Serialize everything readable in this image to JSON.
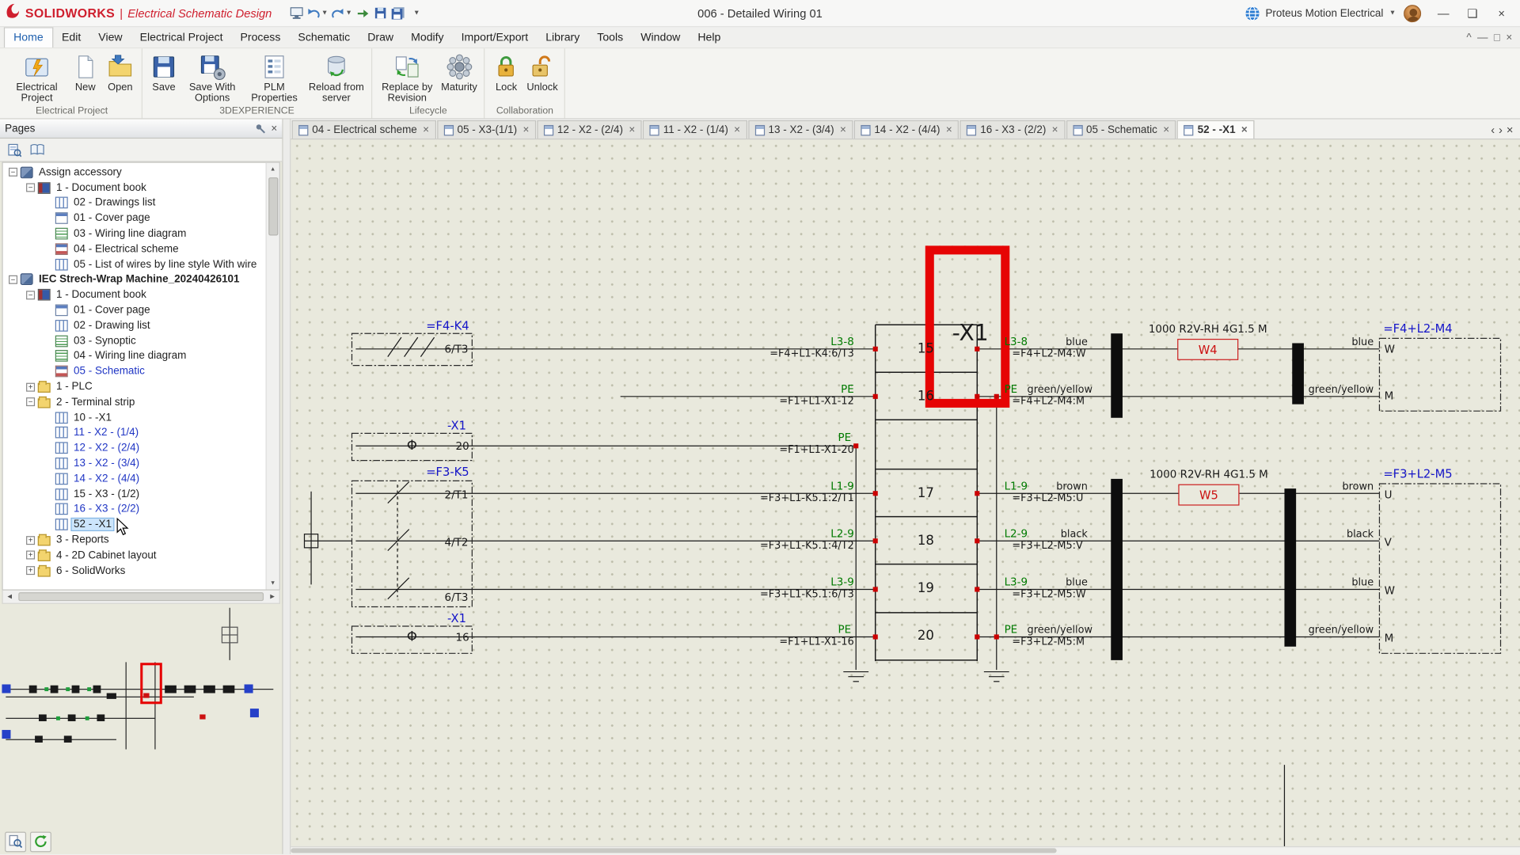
{
  "colors": {
    "brand_red": "#cf1f2e",
    "canvas_beige": "#e9e9dd",
    "wire_label_green": "#007a00",
    "component_tag_blue": "#1414c8",
    "highlight_red": "#e60404",
    "cable_tag_red": "#cc1111",
    "selection_blue": "#cce5fb"
  },
  "title_bar": {
    "brand": "SOLIDWORKS",
    "divider": "|",
    "product": "Electrical Schematic Design",
    "document_title": "006 - Detailed Wiring 01",
    "account_name": "Proteus Motion Electrical",
    "quick_access_icons": [
      "viewer",
      "undo",
      "redo",
      "export",
      "save",
      "save-all",
      "customize"
    ]
  },
  "menu": {
    "active": "Home",
    "items": [
      "Home",
      "Edit",
      "View",
      "Electrical Project",
      "Process",
      "Schematic",
      "Draw",
      "Modify",
      "Import/Export",
      "Library",
      "Tools",
      "Window",
      "Help"
    ]
  },
  "ribbon": {
    "groups": [
      {
        "label": "Electrical Project",
        "buttons": [
          {
            "label": "Electrical Project",
            "icon": "electrical-project"
          },
          {
            "label": "New",
            "icon": "new-document"
          },
          {
            "label": "Open",
            "icon": "open"
          }
        ]
      },
      {
        "label": "3DEXPERIENCE",
        "buttons": [
          {
            "label": "Save",
            "icon": "save"
          },
          {
            "label": "Save With Options",
            "icon": "save-options"
          },
          {
            "label": "PLM Properties",
            "icon": "plm-properties"
          },
          {
            "label": "Reload from server",
            "icon": "reload-server"
          }
        ]
      },
      {
        "label": "Lifecycle",
        "buttons": [
          {
            "label": "Replace by Revision",
            "icon": "replace-revision"
          },
          {
            "label": "Maturity",
            "icon": "maturity"
          }
        ]
      },
      {
        "label": "Collaboration",
        "buttons": [
          {
            "label": "Lock",
            "icon": "lock"
          },
          {
            "label": "Unlock",
            "icon": "unlock"
          }
        ]
      }
    ]
  },
  "pages_panel": {
    "title": "Pages",
    "tree": [
      {
        "label": "Assign accessory",
        "level": 0,
        "icon": "project",
        "twisty": "minus"
      },
      {
        "label": "1 - Document book",
        "level": 1,
        "icon": "book",
        "twisty": "minus"
      },
      {
        "label": "02 - Drawings list",
        "level": 2,
        "icon": "table",
        "twisty": "none"
      },
      {
        "label": "01 - Cover page",
        "level": 2,
        "icon": "page",
        "twisty": "none"
      },
      {
        "label": "03 - Wiring line diagram",
        "level": 2,
        "icon": "page-green",
        "twisty": "none"
      },
      {
        "label": "04 - Electrical scheme",
        "level": 2,
        "icon": "scheme",
        "twisty": "none"
      },
      {
        "label": "05 - List of wires by line style With wire",
        "level": 2,
        "icon": "table",
        "twisty": "none"
      },
      {
        "label": "IEC Strech-Wrap Machine_20240426101",
        "level": 0,
        "icon": "project",
        "twisty": "minus",
        "bold": true
      },
      {
        "label": "1 - Document book",
        "level": 1,
        "icon": "book",
        "twisty": "minus"
      },
      {
        "label": "01 - Cover page",
        "level": 2,
        "icon": "page",
        "twisty": "none"
      },
      {
        "label": "02 - Drawing list",
        "level": 2,
        "icon": "table",
        "twisty": "none"
      },
      {
        "label": "03 - Synoptic",
        "level": 2,
        "icon": "page-green",
        "twisty": "none"
      },
      {
        "label": "04 - Wiring line diagram",
        "level": 2,
        "icon": "page-green",
        "twisty": "none"
      },
      {
        "label": "05 - Schematic",
        "level": 2,
        "icon": "scheme",
        "twisty": "none",
        "open": true
      },
      {
        "label": "1 - PLC",
        "level": 1,
        "icon": "folder",
        "twisty": "plus"
      },
      {
        "label": "2 - Terminal strip",
        "level": 1,
        "icon": "folder",
        "twisty": "minus"
      },
      {
        "label": "10 - -X1",
        "level": 2,
        "icon": "table",
        "twisty": "none"
      },
      {
        "label": "11 - X2 - (1/4)",
        "level": 2,
        "icon": "table",
        "twisty": "none",
        "open": true
      },
      {
        "label": "12 - X2 - (2/4)",
        "level": 2,
        "icon": "table",
        "twisty": "none",
        "open": true
      },
      {
        "label": "13 - X2 - (3/4)",
        "level": 2,
        "icon": "table",
        "twisty": "none",
        "open": true
      },
      {
        "label": "14 - X2 - (4/4)",
        "level": 2,
        "icon": "table",
        "twisty": "none",
        "open": true
      },
      {
        "label": "15 - X3 - (1/2)",
        "level": 2,
        "icon": "table",
        "twisty": "none"
      },
      {
        "label": "16 - X3 - (2/2)",
        "level": 2,
        "icon": "table",
        "twisty": "none",
        "open": true
      },
      {
        "label": "52 - -X1",
        "level": 2,
        "icon": "table",
        "twisty": "none",
        "selected": true
      },
      {
        "label": "3 - Reports",
        "level": 1,
        "icon": "folder",
        "twisty": "plus"
      },
      {
        "label": "4 - 2D Cabinet layout",
        "level": 1,
        "icon": "folder",
        "twisty": "plus"
      },
      {
        "label": "6 - SolidWorks",
        "level": 1,
        "icon": "folder",
        "twisty": "plus"
      }
    ]
  },
  "tabs": {
    "items": [
      {
        "label": "04 - Electrical scheme"
      },
      {
        "label": "05 - X3-(1/1)"
      },
      {
        "label": "12 - X2 - (2/4)"
      },
      {
        "label": "11 - X2 - (1/4)"
      },
      {
        "label": "13 - X2 - (3/4)"
      },
      {
        "label": "14 - X2 - (4/4)"
      },
      {
        "label": "16 - X3 - (2/2)"
      },
      {
        "label": "05 - Schematic"
      },
      {
        "label": "52 - -X1",
        "active": true
      }
    ]
  },
  "schematic": {
    "highlight_label": "-X1",
    "terminal_strip": {
      "numbers": [
        "15",
        "16",
        "17",
        "18",
        "19",
        "20"
      ]
    },
    "components": {
      "k4": {
        "tag": "=F4-K4",
        "pin": "6/T3"
      },
      "x1_top": {
        "tag": "-X1",
        "symbol": "Φ",
        "pin": "20"
      },
      "k5": {
        "tag": "=F3-K5",
        "pins": [
          "2/T1",
          "4/T2",
          "6/T3"
        ]
      },
      "x1_bottom": {
        "tag": "-X1",
        "symbol": "Φ",
        "pin": "16"
      }
    },
    "left_wires": [
      {
        "name": "L3-8",
        "dest": "=F4+L1-K4:6/T3"
      },
      {
        "name": "PE",
        "dest": "=F1+L1-X1-12"
      },
      {
        "name": "PE",
        "dest": "=F1+L1-X1-20"
      },
      {
        "name": "L1-9",
        "dest": "=F3+L1-K5.1:2/T1"
      },
      {
        "name": "L2-9",
        "dest": "=F3+L1-K5.1:4/T2"
      },
      {
        "name": "L3-9",
        "dest": "=F3+L1-K5.1:6/T3"
      },
      {
        "name": "PE",
        "dest": "=F1+L1-X1-16"
      }
    ],
    "right_wires": [
      {
        "name": "L3-8",
        "color": "blue",
        "dest": "=F4+L2-M4:W"
      },
      {
        "name": "PE",
        "color": "green/yellow",
        "dest": "=F4+L2-M4:M"
      },
      {
        "name": "L1-9",
        "color": "brown",
        "dest": "=F3+L2-M5:U"
      },
      {
        "name": "L2-9",
        "color": "black",
        "dest": "=F3+L2-M5:V"
      },
      {
        "name": "L3-9",
        "color": "blue",
        "dest": "=F3+L2-M5:W"
      },
      {
        "name": "PE",
        "color": "green/yellow",
        "dest": "=F3+L2-M5:M"
      }
    ],
    "cables": [
      {
        "spec": "1000 R2V-RH 4G1.5 M",
        "tag": "W4"
      },
      {
        "spec": "1000 R2V-RH 4G1.5 M",
        "tag": "W5"
      }
    ],
    "motors": [
      {
        "tag": "=F4+L2-M4",
        "pins": [
          "W",
          "M"
        ],
        "wire_colors": [
          "blue",
          "green/yellow"
        ]
      },
      {
        "tag": "=F3+L2-M5",
        "pins": [
          "U",
          "V",
          "W",
          "M"
        ],
        "wire_colors": [
          "brown",
          "black",
          "blue",
          "green/yellow"
        ]
      }
    ]
  }
}
